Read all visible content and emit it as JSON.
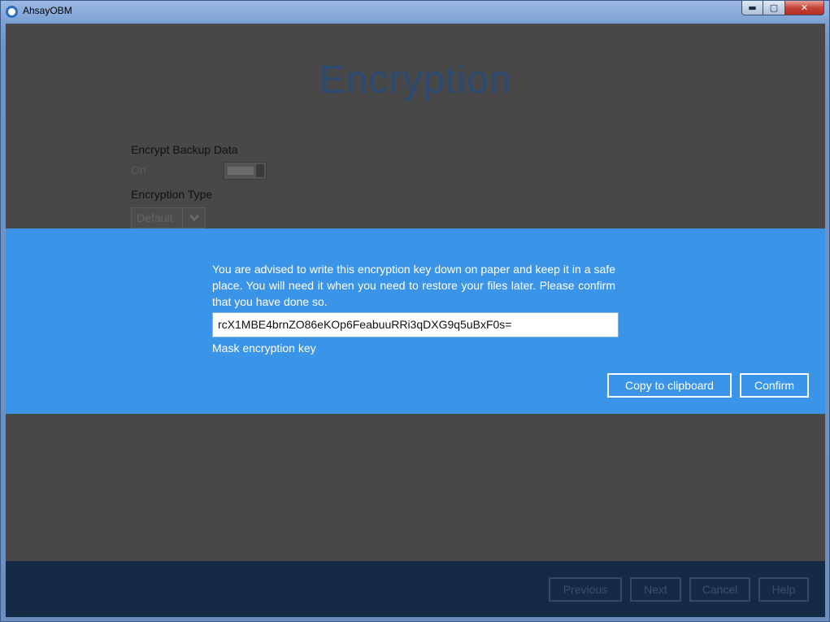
{
  "window": {
    "title": "AhsayOBM",
    "min_symbol": "▬",
    "max_symbol": "▢",
    "close_symbol": "✕"
  },
  "page": {
    "title": "Encryption"
  },
  "encrypt_backup": {
    "label": "Encrypt Backup Data",
    "state": "On"
  },
  "encryption_type": {
    "label": "Encryption Type",
    "value": "Default"
  },
  "dialog": {
    "advice": "You are advised to write this encryption key down on paper and keep it in a safe place. You will need it when you need to restore your files later. Please confirm that you have done so.",
    "key_value": "rcX1MBE4brnZO86eKOp6FeabuuRRi3qDXG9q5uBxF0s=",
    "mask_label": "Mask encryption key",
    "copy_label": "Copy to clipboard",
    "confirm_label": "Confirm"
  },
  "footer": {
    "previous": "Previous",
    "next": "Next",
    "cancel": "Cancel",
    "help": "Help"
  },
  "colors": {
    "banner": "#3a94e8",
    "overlay": "#484848",
    "footer": "#152a45",
    "title": "#2b4a72"
  }
}
